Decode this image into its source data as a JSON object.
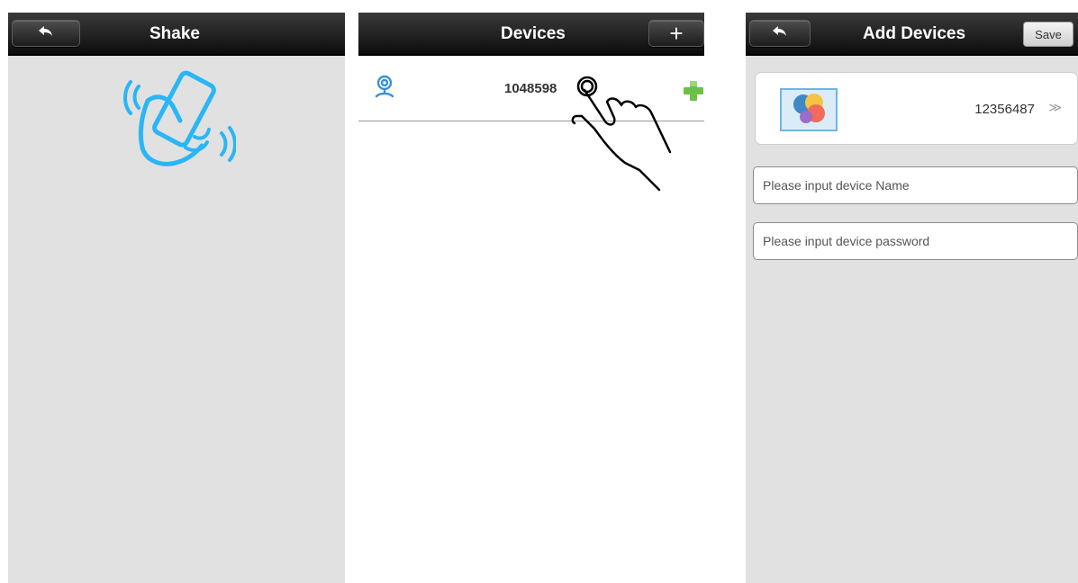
{
  "shake_screen": {
    "title": "Shake",
    "back_icon": "back-arrow-icon",
    "illustration_icon": "shake-phone-icon",
    "accent_color": "#29b6f6"
  },
  "devices_screen": {
    "title": "Devices",
    "add_button_label": "+",
    "devices": [
      {
        "name": "1048598",
        "icon": "camera-icon",
        "action_icon": "green-plus-icon"
      }
    ],
    "gesture_icon": "tap-hand-icon"
  },
  "add_devices_screen": {
    "title": "Add Devices",
    "save_label": "Save",
    "back_icon": "back-arrow-icon",
    "device_id": "12356487",
    "chevron": "≫",
    "name_field": {
      "placeholder": "Please input device Name",
      "value": ""
    },
    "password_field": {
      "placeholder": "Please input device password",
      "value": ""
    }
  },
  "colors": {
    "titlebar": "#1a1a1a",
    "screen_background": "#e1e1e1",
    "camera_blue": "#3a8fd8",
    "plus_green": "#6cc04a"
  }
}
